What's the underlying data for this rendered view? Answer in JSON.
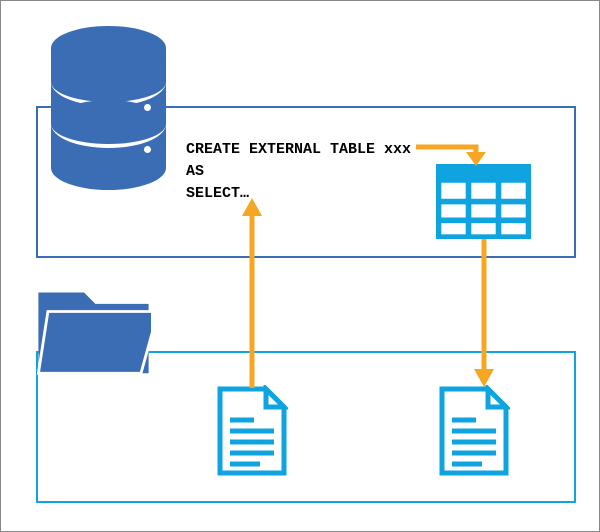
{
  "sql": {
    "line1": "CREATE EXTERNAL TABLE xxx",
    "line2": "AS",
    "line3": "SELECT…"
  },
  "icons": {
    "database": "database-icon",
    "folder": "folder-icon",
    "table": "table-grid-icon",
    "document_source": "document-icon",
    "document_output": "document-icon"
  },
  "arrows": {
    "sql_to_table": "right-down",
    "table_to_output_doc": "down",
    "source_doc_to_sql": "up"
  },
  "colors": {
    "db_blue": "#3b6db5",
    "cyan": "#0fa3e0",
    "arrow": "#f5a623"
  }
}
